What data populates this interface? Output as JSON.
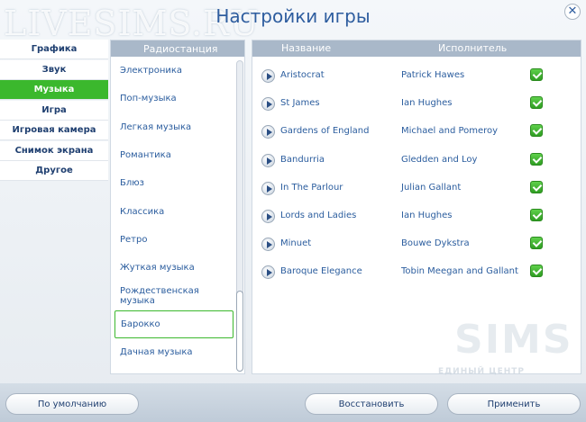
{
  "watermark": "LIVESIMS.RU",
  "title": "Настройки игры",
  "close_glyph": "✕",
  "nav": {
    "items": [
      {
        "label": "Графика",
        "active": false
      },
      {
        "label": "Звук",
        "active": false
      },
      {
        "label": "Музыка",
        "active": true
      },
      {
        "label": "Игра",
        "active": false
      },
      {
        "label": "Игровая камера",
        "active": false
      },
      {
        "label": "Снимок экрана",
        "active": false
      },
      {
        "label": "Другое",
        "active": false
      }
    ]
  },
  "stations": {
    "header": "Радиостанция",
    "items": [
      {
        "label": "Электроника",
        "selected": false
      },
      {
        "label": "Поп-музыка",
        "selected": false
      },
      {
        "label": "Легкая музыка",
        "selected": false
      },
      {
        "label": "Романтика",
        "selected": false
      },
      {
        "label": "Блюз",
        "selected": false
      },
      {
        "label": "Классика",
        "selected": false
      },
      {
        "label": "Ретро",
        "selected": false
      },
      {
        "label": "Жуткая музыка",
        "selected": false
      },
      {
        "label": "Рождественская музыка",
        "selected": false
      },
      {
        "label": "Барокко",
        "selected": true
      },
      {
        "label": "Дачная музыка",
        "selected": false
      }
    ]
  },
  "tracks": {
    "header_name": "Название",
    "header_artist": "Исполнитель",
    "rows": [
      {
        "name": "Aristocrat",
        "artist": "Patrick Hawes",
        "enabled": true
      },
      {
        "name": "St James",
        "artist": "Ian Hughes",
        "enabled": true
      },
      {
        "name": "Gardens of England",
        "artist": "Michael and Pomeroy",
        "enabled": true
      },
      {
        "name": "Bandurria",
        "artist": "Gledden and Loy",
        "enabled": true
      },
      {
        "name": "In The Parlour",
        "artist": "Julian Gallant",
        "enabled": true
      },
      {
        "name": "Lords and Ladies",
        "artist": "Ian Hughes",
        "enabled": true
      },
      {
        "name": "Minuet",
        "artist": "Bouwe Dykstra",
        "enabled": true
      },
      {
        "name": "Baroque Elegance",
        "artist": "Tobin Meegan and Gallant",
        "enabled": true
      }
    ]
  },
  "logo": {
    "big": "SIMS",
    "small": "ЕДИНЫЙ ЦЕНТР"
  },
  "buttons": {
    "defaults": "По умолчанию",
    "restore": "Восстановить",
    "apply": "Применить"
  },
  "colors": {
    "accent_green": "#3bb82d",
    "text_blue": "#2b5d9e",
    "header_gray": "#a9b8c9"
  }
}
